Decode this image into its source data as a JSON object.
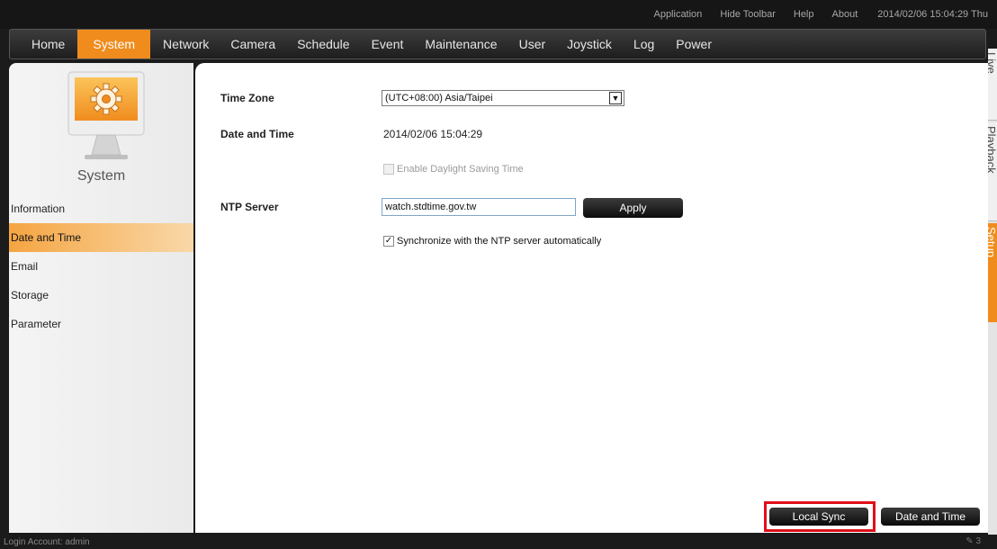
{
  "topbar": {
    "links": [
      "Application",
      "Hide Toolbar",
      "Help",
      "About"
    ],
    "datetime": "2014/02/06 15:04:29 Thu"
  },
  "nav": {
    "items": [
      "Home",
      "System",
      "Network",
      "Camera",
      "Schedule",
      "Event",
      "Maintenance",
      "User",
      "Joystick",
      "Log",
      "Power"
    ],
    "active": "System"
  },
  "side_tabs": {
    "live": "Live",
    "playback": "Playback",
    "setup": "Setup",
    "active": "Setup"
  },
  "sidebar": {
    "title": "System",
    "icon": "gear-monitor-icon",
    "items": [
      "Information",
      "Date and Time",
      "Email",
      "Storage",
      "Parameter"
    ],
    "active": "Date and Time"
  },
  "form": {
    "time_zone_label": "Time Zone",
    "time_zone_value": "(UTC+08:00) Asia/Taipei",
    "date_time_label": "Date and Time",
    "date_time_value": "2014/02/06 15:04:29",
    "dst_label": "Enable Daylight Saving Time",
    "dst_checked": false,
    "ntp_label": "NTP Server",
    "ntp_value": "watch.stdtime.gov.tw",
    "apply_label": "Apply",
    "sync_label": "Synchronize with the NTP server automatically",
    "sync_checked": true
  },
  "actions": {
    "local_sync": "Local Sync",
    "date_and_time": "Date and Time"
  },
  "status": {
    "login": "Login Account: admin",
    "indicator": "3"
  },
  "colors": {
    "accent": "#f08c1e",
    "highlight": "#e0101a"
  }
}
